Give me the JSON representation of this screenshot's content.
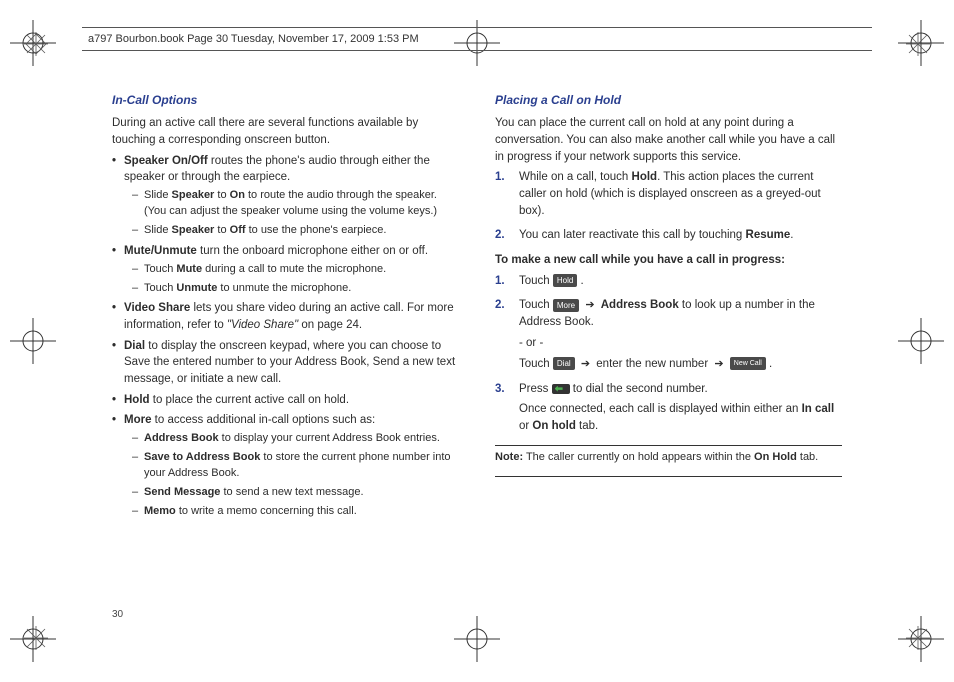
{
  "header": {
    "text": "a797 Bourbon.book  Page 30  Tuesday, November 17, 2009  1:53 PM"
  },
  "page_number": "30",
  "left": {
    "title": "In-Call Options",
    "intro": "During an active call there are several functions available by touching a corresponding onscreen button.",
    "items": {
      "speaker": {
        "lead_bold": "Speaker On/Off",
        "lead_rest": " routes the phone's audio through either the speaker or through the earpiece.",
        "sub": [
          {
            "pre": "Slide ",
            "b1": "Speaker",
            "mid": " to ",
            "b2": "On",
            "post": " to route the audio through the speaker. (You can adjust the speaker volume using the volume keys.)"
          },
          {
            "pre": "Slide ",
            "b1": "Speaker",
            "mid": " to ",
            "b2": "Off",
            "post": " to use the phone's earpiece."
          }
        ]
      },
      "mute": {
        "lead_bold": "Mute/Unmute",
        "lead_rest": " turn the onboard microphone either on or off.",
        "sub": [
          {
            "pre": "Touch ",
            "b1": "Mute",
            "post": " during a call to mute the microphone."
          },
          {
            "pre": "Touch ",
            "b1": "Unmute",
            "post": " to unmute the microphone."
          }
        ]
      },
      "vshare": {
        "lead_bold": "Video Share",
        "lead_rest_a": " lets you share video during an active call. For more information, refer to ",
        "ref": "\"Video Share\" ",
        "lead_rest_b": " on page 24."
      },
      "dial": {
        "lead_bold": "Dial",
        "lead_rest": " to display the onscreen keypad, where you can choose to Save the entered number to your Address Book, Send a new text message, or initiate a new call."
      },
      "hold": {
        "lead_bold": "Hold",
        "lead_rest": " to place the current active call on hold."
      },
      "more": {
        "lead_bold": "More",
        "lead_rest": " to access additional in-call options such as:",
        "sub": [
          {
            "b1": "Address Book",
            "post": " to display your current Address Book entries."
          },
          {
            "b1": "Save to Address Book",
            "post": " to store the current phone number into your Address Book."
          },
          {
            "b1": "Send Message",
            "post": " to send a new text message."
          },
          {
            "b1": "Memo",
            "post": " to write a memo concerning this call."
          }
        ]
      }
    }
  },
  "right": {
    "title": "Placing a Call on Hold",
    "intro": "You can place the current call on hold at any point during a conversation. You can also make another call while you have a call in progress if your network supports this service.",
    "steps_a": {
      "s1": {
        "pre": "While on a call, touch ",
        "b": "Hold",
        "post": ". This action places the current caller on hold (which is displayed onscreen as a greyed-out box)."
      },
      "s2": {
        "pre": "You can later reactivate this call by touching ",
        "b": "Resume",
        "post": "."
      }
    },
    "subhead": "To make a new call while you have a call in progress:",
    "steps_b": {
      "s1": {
        "pre": "Touch ",
        "btn": "Hold",
        "post": " ."
      },
      "s2": {
        "pre": "Touch ",
        "btn": "More",
        "mid_b": "Address Book",
        "mid_rest": " to look up a number in the Address Book.",
        "or": "- or -",
        "alt_pre": "Touch ",
        "alt_btn": "Dial",
        "alt_mid": " enter the new number ",
        "alt_btn2": "New Call",
        "alt_post": " ."
      },
      "s3": {
        "pre": "Press ",
        "post": " to dial the second number.",
        "tail_a": "Once connected, each call is displayed within either an ",
        "tail_b1": "In call",
        "tail_mid": " or ",
        "tail_b2": "On hold",
        "tail_end": " tab."
      }
    },
    "note": {
      "label": "Note:",
      "text": " The caller currently on hold appears within the ",
      "b": "On Hold",
      "tail": " tab."
    }
  }
}
